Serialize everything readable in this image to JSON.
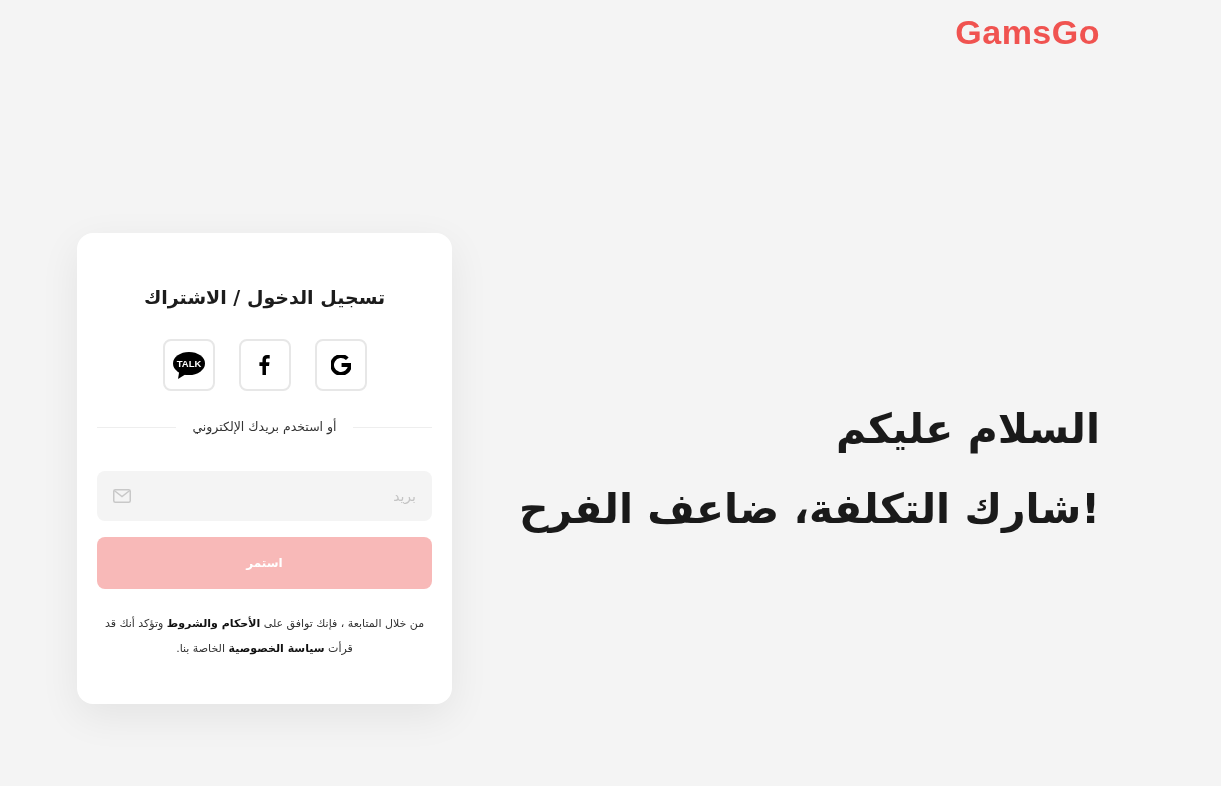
{
  "header": {
    "logo": "GamsGo"
  },
  "login_card": {
    "title": "تسجيل الدخول / الاشتراك",
    "social_buttons": [
      {
        "kind": "google"
      },
      {
        "kind": "facebook"
      },
      {
        "kind": "talk",
        "badge": "TALK"
      }
    ],
    "divider": "أو استخدم بريدك الإلكتروني",
    "email_field": {
      "placeholder": "بريد"
    },
    "continue_button": {
      "label": "استمر",
      "disabled": true
    },
    "legal": {
      "before": "من خلال المتابعة ، فإنك توافق على",
      "terms_link": "الأحكام والشروط",
      "middle": "وتؤكد أنك قد قرأت",
      "privacy_link": "سياسة الخصوصية",
      "after": "الخاصة بنا."
    }
  },
  "hero": {
    "greeting": "السلام عليكم",
    "slogan": "شارك التكلفة، ضاعف الفرح!"
  }
}
